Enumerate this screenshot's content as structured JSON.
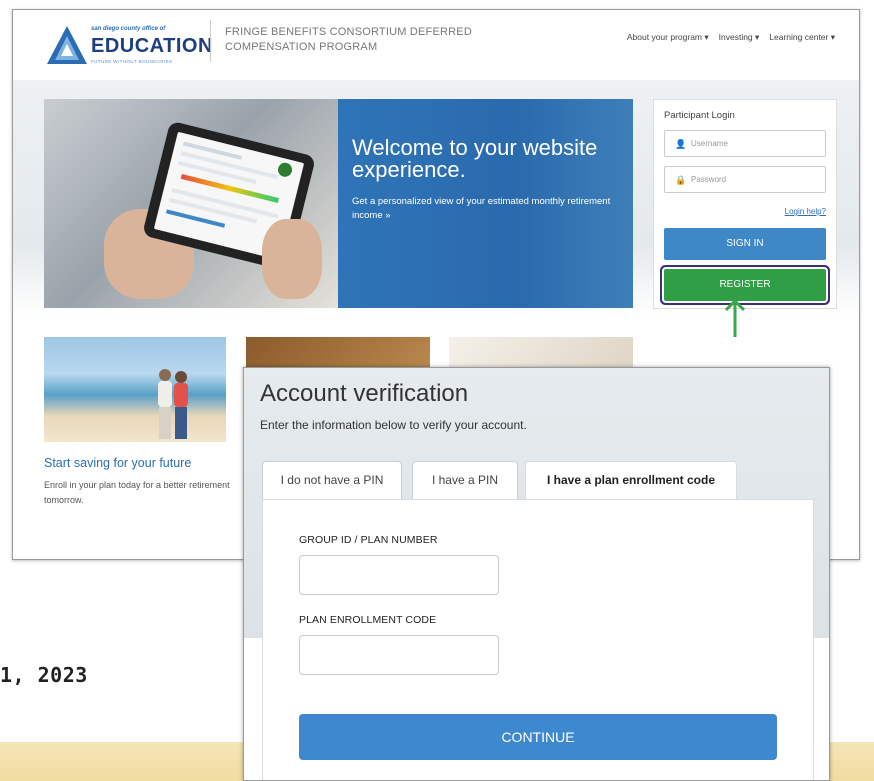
{
  "site": {
    "logo": {
      "small": "san diego county office of",
      "main": "EDUCATION",
      "tagline": "FUTURE WITHOUT BOUNDARIES"
    },
    "program_title": "FRINGE BENEFITS CONSORTIUM DEFERRED COMPENSATION PROGRAM",
    "nav": [
      "About your program ▾",
      "Investing ▾",
      "Learning center ▾"
    ],
    "hero": {
      "title": "Welcome to your website experience.",
      "subtitle": "Get a personalized view of your estimated monthly retirement income »"
    },
    "login": {
      "title": "Participant Login",
      "username_placeholder": "Username",
      "password_placeholder": "Password",
      "help": "Login help?",
      "signin": "SIGN IN",
      "register": "REGISTER"
    },
    "card": {
      "title": "Start saving for your future",
      "desc": "Enroll in your plan today for a better retirement tomorrow."
    },
    "colors": {
      "brand_blue": "#2a6db5",
      "register_green": "#2f9e44",
      "arrow_green": "#3aa84a"
    }
  },
  "dialog": {
    "title": "Account verification",
    "subtitle": "Enter the information below to verify your account.",
    "tabs": [
      "I do not have a PIN",
      "I have a PIN",
      "I have a plan enrollment code"
    ],
    "active_tab": "I have a plan enrollment code",
    "fields": [
      {
        "label": "GROUP ID / PLAN NUMBER",
        "value": ""
      },
      {
        "label": "PLAN ENROLLMENT CODE",
        "value": ""
      }
    ],
    "continue": "CONTINUE"
  },
  "date_fragment": "1, 2023"
}
